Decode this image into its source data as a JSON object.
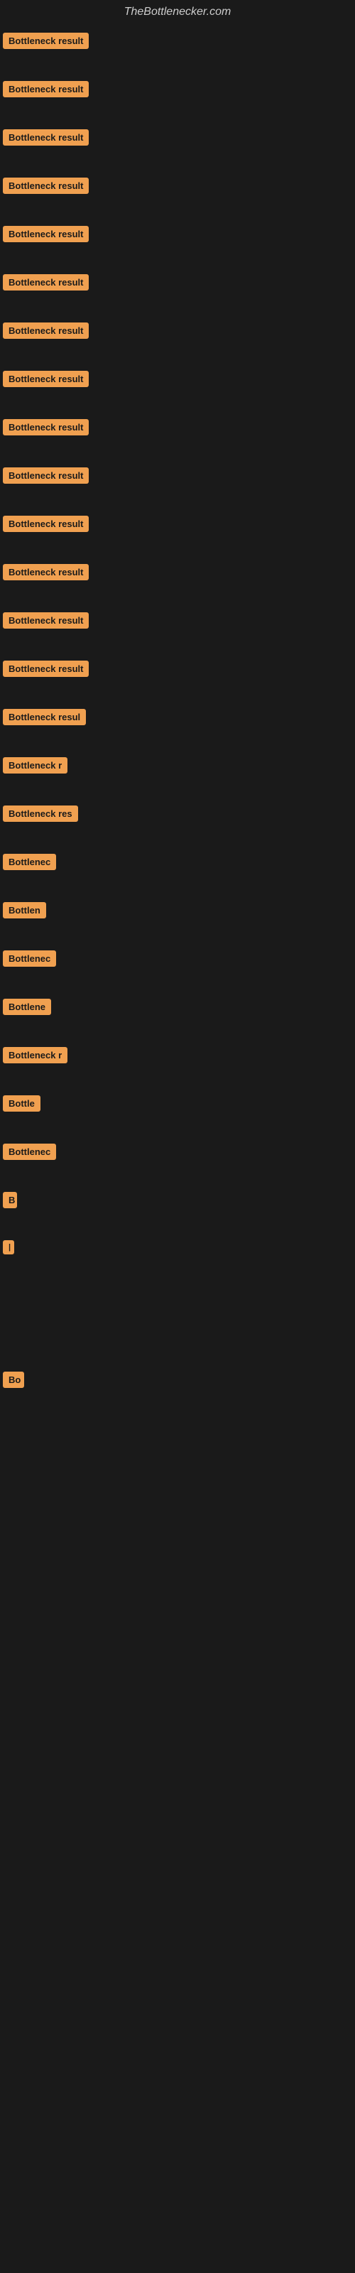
{
  "site": {
    "title": "TheBottlenecker.com"
  },
  "items": [
    {
      "label": "Bottleneck result",
      "width": 140
    },
    {
      "label": "Bottleneck result",
      "width": 140
    },
    {
      "label": "Bottleneck result",
      "width": 140
    },
    {
      "label": "Bottleneck result",
      "width": 140
    },
    {
      "label": "Bottleneck result",
      "width": 140
    },
    {
      "label": "Bottleneck result",
      "width": 140
    },
    {
      "label": "Bottleneck result",
      "width": 140
    },
    {
      "label": "Bottleneck result",
      "width": 140
    },
    {
      "label": "Bottleneck result",
      "width": 140
    },
    {
      "label": "Bottleneck result",
      "width": 140
    },
    {
      "label": "Bottleneck result",
      "width": 140
    },
    {
      "label": "Bottleneck result",
      "width": 140
    },
    {
      "label": "Bottleneck result",
      "width": 140
    },
    {
      "label": "Bottleneck result",
      "width": 140
    },
    {
      "label": "Bottleneck resul",
      "width": 125
    },
    {
      "label": "Bottleneck r",
      "width": 100
    },
    {
      "label": "Bottleneck res",
      "width": 110
    },
    {
      "label": "Bottlenec",
      "width": 88
    },
    {
      "label": "Bottlen",
      "width": 72
    },
    {
      "label": "Bottlenec",
      "width": 88
    },
    {
      "label": "Bottlene",
      "width": 78
    },
    {
      "label": "Bottleneck r",
      "width": 100
    },
    {
      "label": "Bottle",
      "width": 62
    },
    {
      "label": "Bottlenec",
      "width": 88
    },
    {
      "label": "B",
      "width": 20
    },
    {
      "label": "|",
      "width": 10
    },
    {
      "label": "",
      "width": 0
    },
    {
      "label": "",
      "width": 0
    },
    {
      "label": "",
      "width": 0
    },
    {
      "label": "Bo",
      "width": 30
    },
    {
      "label": "",
      "width": 0
    },
    {
      "label": "",
      "width": 0
    },
    {
      "label": "",
      "width": 0
    }
  ]
}
